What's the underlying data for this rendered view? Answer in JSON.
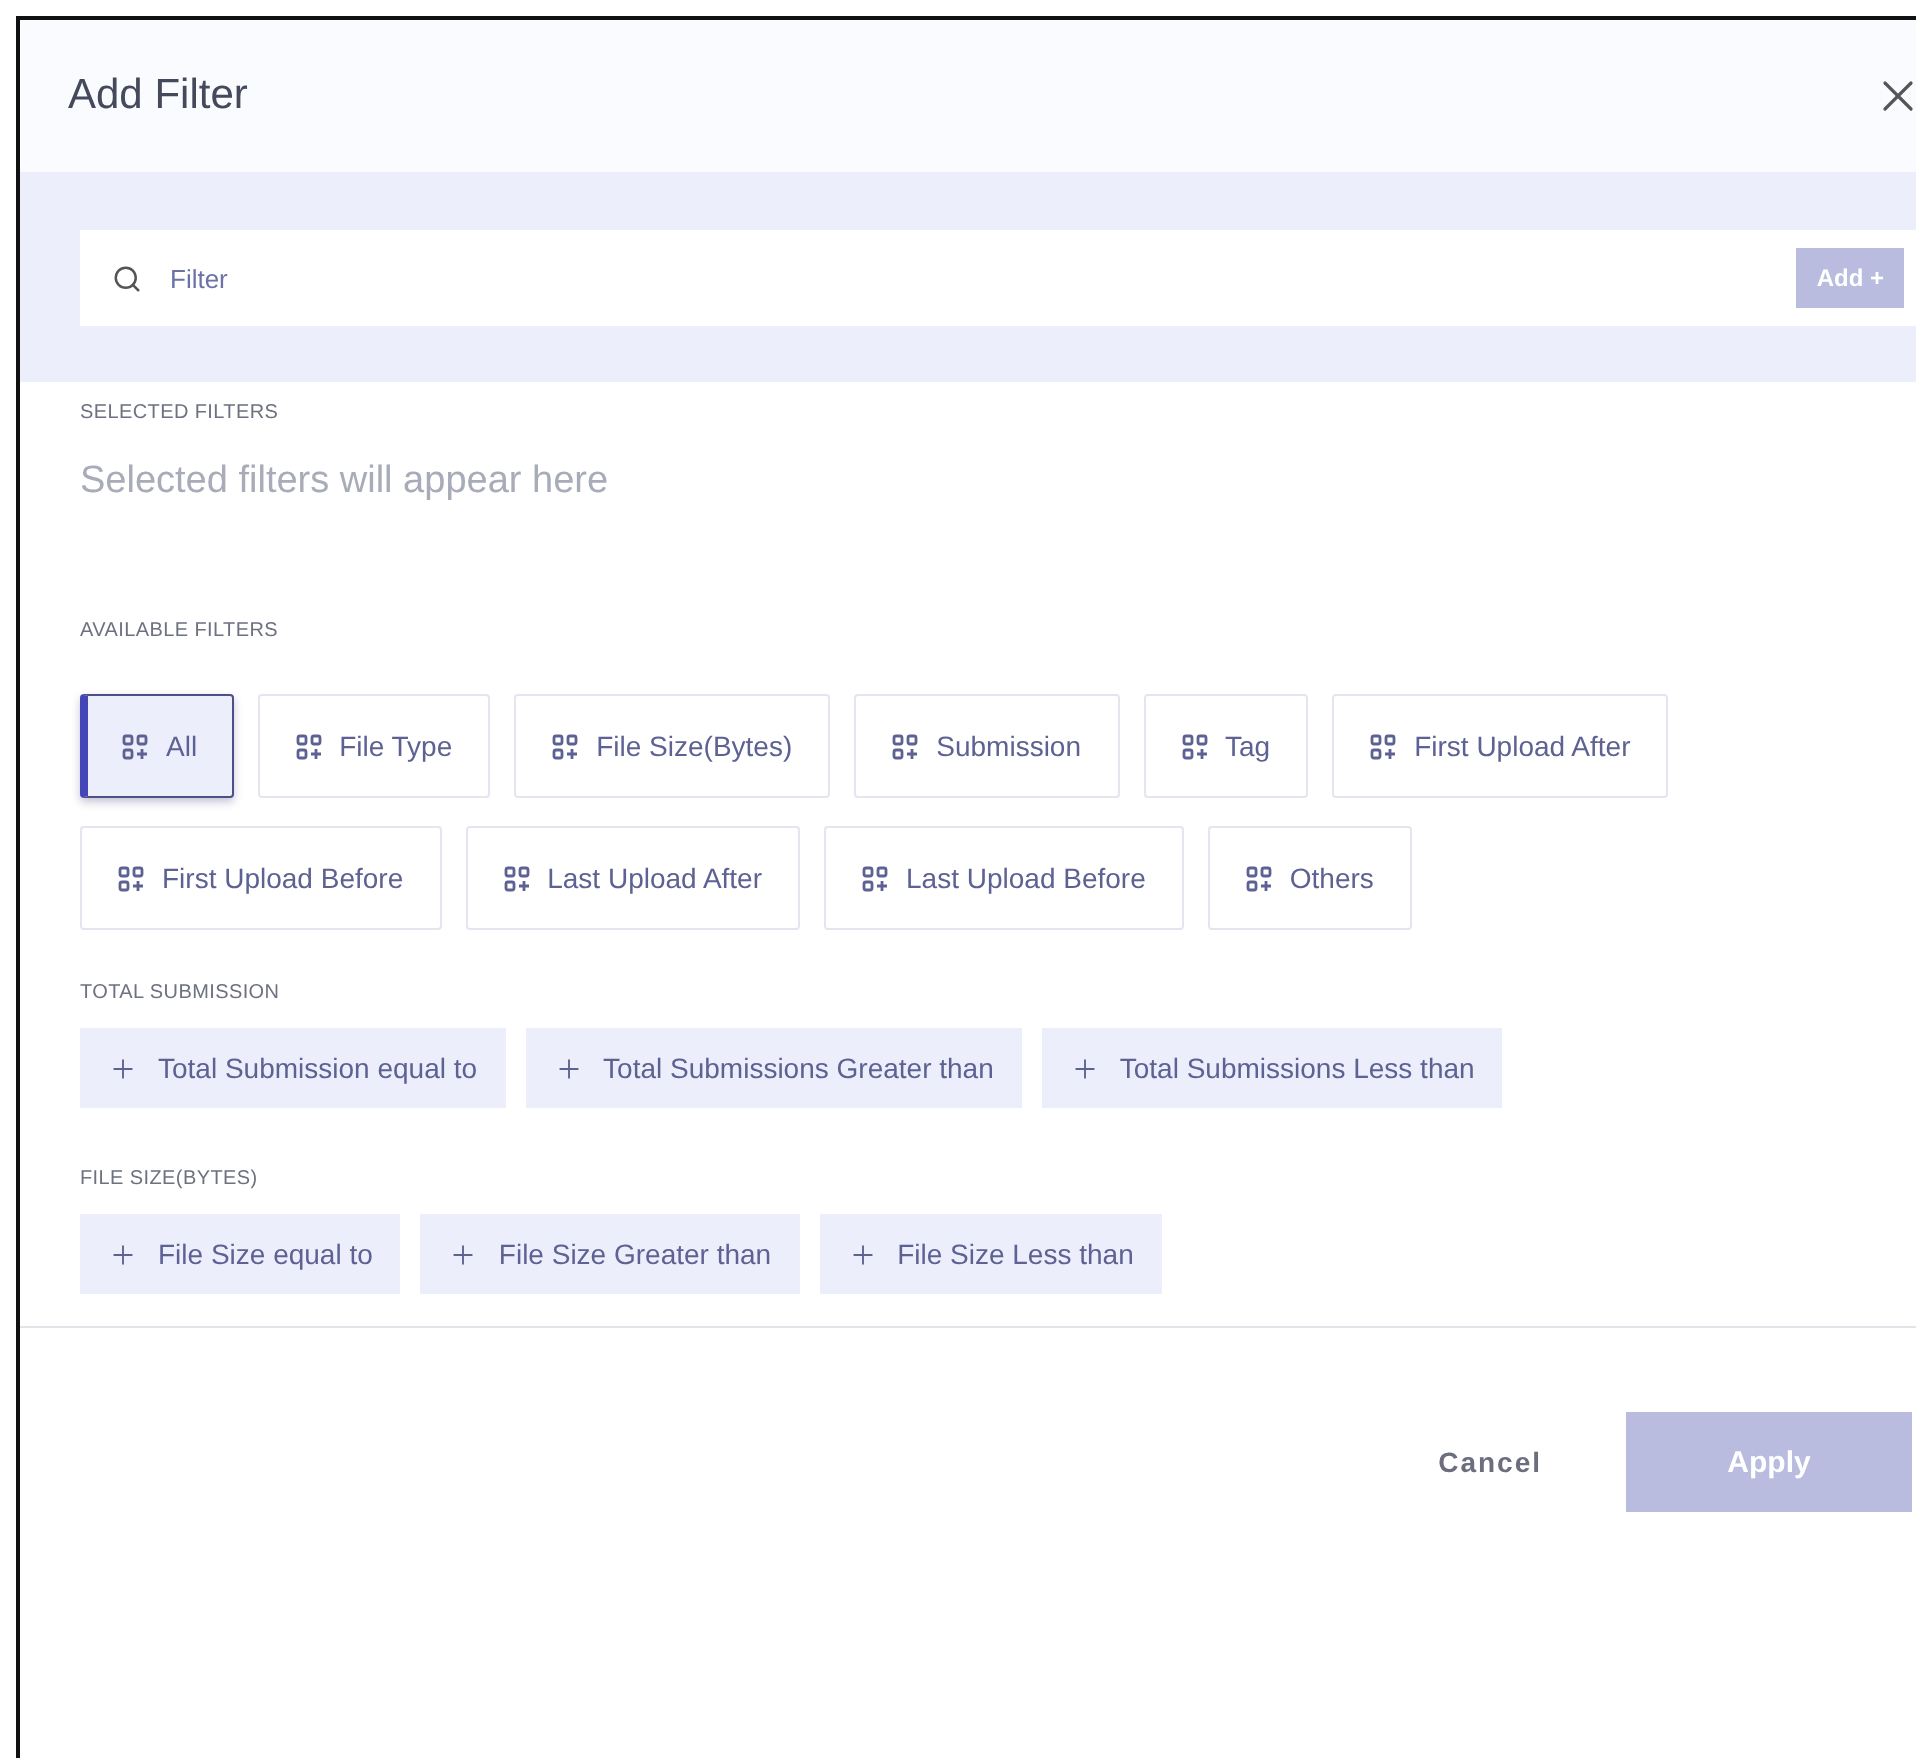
{
  "dialog": {
    "title": "Add Filter"
  },
  "search": {
    "placeholder": "Filter",
    "add_button": "Add +"
  },
  "selected_filters": {
    "heading": "SELECTED FILTERS",
    "empty_text": "Selected filters will appear here"
  },
  "available_filters": {
    "heading": "AVAILABLE FILTERS",
    "items": [
      {
        "label": "All",
        "selected": true
      },
      {
        "label": "File Type",
        "selected": false
      },
      {
        "label": "File Size(Bytes)",
        "selected": false
      },
      {
        "label": "Submission",
        "selected": false
      },
      {
        "label": "Tag",
        "selected": false
      },
      {
        "label": "First Upload After",
        "selected": false
      },
      {
        "label": "First Upload Before",
        "selected": false
      },
      {
        "label": "Last Upload After",
        "selected": false
      },
      {
        "label": "Last Upload Before",
        "selected": false
      },
      {
        "label": "Others",
        "selected": false
      }
    ]
  },
  "groups": [
    {
      "heading": "TOTAL SUBMISSION",
      "options": [
        "Total Submission equal to",
        "Total Submissions Greater than",
        "Total Submissions Less than"
      ]
    },
    {
      "heading": "FILE SIZE(BYTES)",
      "options": [
        "File Size equal to",
        "File Size Greater than",
        "File Size Less than"
      ]
    }
  ],
  "footer": {
    "cancel": "Cancel",
    "apply": "Apply",
    "apply_disabled": true
  }
}
